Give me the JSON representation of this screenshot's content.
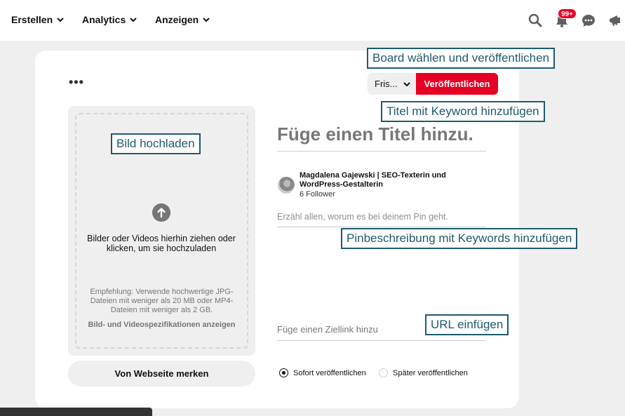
{
  "nav": {
    "create": "Erstellen",
    "analytics": "Analytics",
    "ads": "Anzeigen",
    "notifications_badge": "99+"
  },
  "icons": {
    "search": "search-icon",
    "bell": "bell-icon",
    "chat": "chat-icon",
    "megaphone": "megaphone-icon"
  },
  "colors": {
    "brand_red": "#e60023",
    "callout_border": "#1f5a6e"
  },
  "editor": {
    "more_options": "•••",
    "board_select": "Fris...",
    "publish_button": "Veröffentlichen",
    "upload_text": "Bilder oder Videos hierhin ziehen oder klicken, um sie hochzuladen",
    "upload_recommendation": "Empfehlung: Verwende hochwertige JPG-Dateien mit weniger als 20 MB oder MP4-Dateien mit weniger als 2 GB.",
    "upload_specs_link": "Bild- und Videospezifikationen anzeigen",
    "save_from_site": "Von Webseite merken",
    "title_placeholder": "Füge einen Titel hinzu.",
    "author_name": "Magdalena Gajewski | SEO-Texterin und WordPress-Gestalterin",
    "author_followers": "6 Follower",
    "description_placeholder": "Erzähl allen, worum es bei deinem Pin geht.",
    "link_placeholder": "Füge einen Ziellink hinzu",
    "publish_now": "Sofort veröffentlichen",
    "publish_later": "Später veröffentlichen",
    "publish_now_selected": true
  },
  "callouts": {
    "board": "Board wählen und veröffentlichen",
    "title": "Titel mit Keyword hinzufügen",
    "image": "Bild hochladen",
    "description": "Pinbeschreibung mit Keywords hinzufügen",
    "url": "URL einfügen"
  }
}
